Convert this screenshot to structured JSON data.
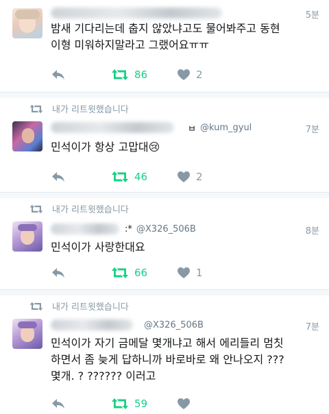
{
  "tweets": [
    {
      "retweet_note": "",
      "handle": "",
      "time": "5분",
      "text": "밤새 기다리는데 춥지 않았냐고도 물어봐주고 동현\n이형 미워하지말라고 그랬어요ㅠㅠ",
      "retweets": "86",
      "likes": "2"
    },
    {
      "retweet_note": "내가 리트윗했습니다",
      "handle": "@kum_gyul",
      "time": "7분",
      "text": "민석이가 항상 고맙대😢",
      "retweets": "46",
      "likes": "2"
    },
    {
      "retweet_note": "내가 리트윗했습니다",
      "handle": "@X326_506B",
      "time": "8분",
      "text": "민석이가 사랑한대요",
      "retweets": "66",
      "likes": "1"
    },
    {
      "retweet_note": "내가 리트윗했습니다",
      "handle": "@X326_506B",
      "time": "7분",
      "text": "민석이가 자기 금메달 몇개냐고 해서 에리들리 멈칫\n하면서 좀 늦게 답하니까 바로바로 왜 안나오지 ???\n몇개. ? ?????? 이러고",
      "retweets": "59",
      "likes": ""
    }
  ],
  "colors": {
    "retweet_green": "#19cf86",
    "muted_gray": "#8899a6",
    "text": "#14171a"
  },
  "icons": [
    "reply-icon",
    "retweet-icon",
    "heart-icon",
    "retweet-small-icon"
  ]
}
